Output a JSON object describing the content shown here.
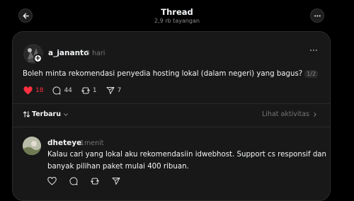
{
  "header": {
    "title": "Thread",
    "views": "2,9 rb tayangan"
  },
  "post": {
    "username": "a_jananto",
    "time": "3 hari",
    "text": "Boleh minta rekomendasi penyedia hosting lokal (dalam negeri) yang bagus?",
    "page_badge": "1/2",
    "likes": "18",
    "comments": "44",
    "reposts": "1",
    "shares": "7",
    "liked": true,
    "like_color": "#ff3040"
  },
  "sort": {
    "label": "Terbaru",
    "activity_link": "Lihat aktivitas"
  },
  "reply": {
    "username": "dheteye",
    "time": "1menit",
    "text_line1": "Kalau cari yang lokal aku rekomendasiin idwebhost. Support cs responsif dan",
    "text_line2": "banyak pilihan paket mulai 400 ribuan."
  },
  "icons": {
    "back": "arrow-left-icon",
    "menu": "more-horizontal-icon",
    "like": "heart-icon",
    "comment": "comment-bubble-icon",
    "repost": "repost-icon",
    "share": "send-icon",
    "sort": "sort-arrows-icon"
  }
}
